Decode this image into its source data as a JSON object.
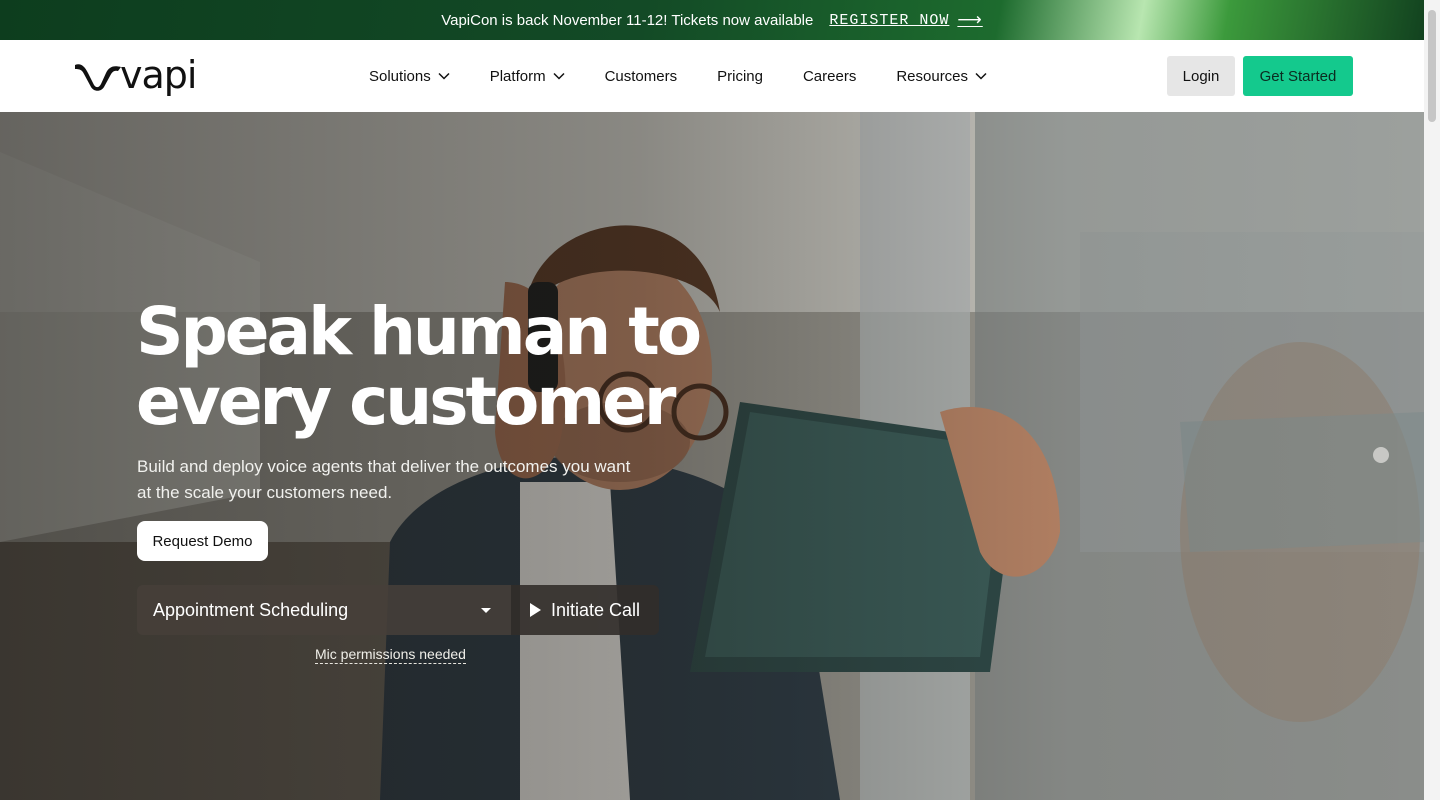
{
  "banner": {
    "text": "VapiCon is back November 11-12! Tickets now available",
    "link_label": "REGISTER NOW",
    "arrow_icon": "arrow-right-icon"
  },
  "header": {
    "logo_text": "vapi",
    "nav": [
      {
        "label": "Solutions",
        "has_dropdown": true
      },
      {
        "label": "Platform",
        "has_dropdown": true
      },
      {
        "label": "Customers",
        "has_dropdown": false
      },
      {
        "label": "Pricing",
        "has_dropdown": false
      },
      {
        "label": "Careers",
        "has_dropdown": false
      },
      {
        "label": "Resources",
        "has_dropdown": true
      }
    ],
    "login_label": "Login",
    "get_started_label": "Get Started"
  },
  "hero": {
    "headline_line1": "Speak human to",
    "headline_line2": "every customer",
    "subtext": "Build and deploy voice agents that deliver the outcomes you want at the scale your customers need.",
    "demo_label": "Request Demo",
    "call_select_value": "Appointment Scheduling",
    "call_button_label": "Initiate Call",
    "mic_note": "Mic permissions needed"
  },
  "colors": {
    "accent_green": "#14c98d",
    "banner_green": "#134a26",
    "login_bg": "#e6e6e6"
  }
}
